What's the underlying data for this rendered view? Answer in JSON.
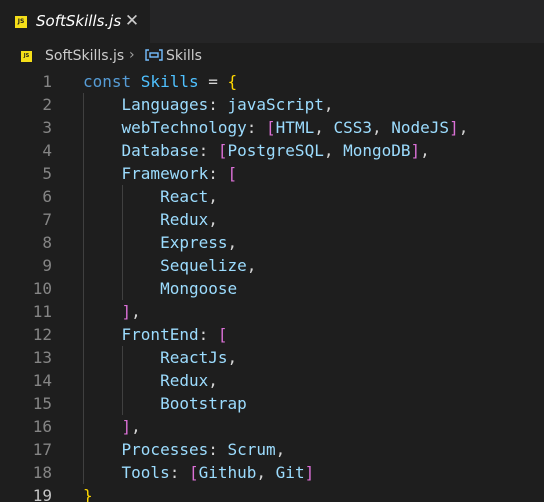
{
  "tab": {
    "badge": "JS",
    "label": "SoftSkills.js",
    "close_glyph": "✕",
    "icon": "javascript-file-icon"
  },
  "breadcrumb": {
    "badge": "JS",
    "file": "SoftSkills.js",
    "separator": "›",
    "symbol_icon": "variable-symbol-icon",
    "symbol": "Skills"
  },
  "editor": {
    "active_line": 19,
    "lines": [
      {
        "n": "1",
        "tokens": [
          [
            "kw",
            "const "
          ],
          [
            "cn",
            "Skills"
          ],
          [
            "op",
            " = "
          ],
          [
            "br1",
            "{"
          ]
        ]
      },
      {
        "n": "2",
        "tokens": [
          [
            "op",
            "    "
          ],
          [
            "pr",
            "Languages"
          ],
          [
            "op",
            ": "
          ],
          [
            "vr",
            "javaScript"
          ],
          [
            "op",
            ","
          ]
        ]
      },
      {
        "n": "3",
        "tokens": [
          [
            "op",
            "    "
          ],
          [
            "pr",
            "webTechnology"
          ],
          [
            "op",
            ": "
          ],
          [
            "br2",
            "["
          ],
          [
            "vr",
            "HTML"
          ],
          [
            "op",
            ", "
          ],
          [
            "vr",
            "CSS3"
          ],
          [
            "op",
            ", "
          ],
          [
            "vr",
            "NodeJS"
          ],
          [
            "br2",
            "]"
          ],
          [
            "op",
            ","
          ]
        ]
      },
      {
        "n": "4",
        "tokens": [
          [
            "op",
            "    "
          ],
          [
            "pr",
            "Database"
          ],
          [
            "op",
            ": "
          ],
          [
            "br2",
            "["
          ],
          [
            "vr",
            "PostgreSQL"
          ],
          [
            "op",
            ", "
          ],
          [
            "vr",
            "MongoDB"
          ],
          [
            "br2",
            "]"
          ],
          [
            "op",
            ","
          ]
        ]
      },
      {
        "n": "5",
        "tokens": [
          [
            "op",
            "    "
          ],
          [
            "pr",
            "Framework"
          ],
          [
            "op",
            ": "
          ],
          [
            "br2",
            "["
          ]
        ]
      },
      {
        "n": "6",
        "tokens": [
          [
            "op",
            "        "
          ],
          [
            "vr",
            "React"
          ],
          [
            "op",
            ","
          ]
        ]
      },
      {
        "n": "7",
        "tokens": [
          [
            "op",
            "        "
          ],
          [
            "vr",
            "Redux"
          ],
          [
            "op",
            ","
          ]
        ]
      },
      {
        "n": "8",
        "tokens": [
          [
            "op",
            "        "
          ],
          [
            "vr",
            "Express"
          ],
          [
            "op",
            ","
          ]
        ]
      },
      {
        "n": "9",
        "tokens": [
          [
            "op",
            "        "
          ],
          [
            "vr",
            "Sequelize"
          ],
          [
            "op",
            ","
          ]
        ]
      },
      {
        "n": "10",
        "tokens": [
          [
            "op",
            "        "
          ],
          [
            "vr",
            "Mongoose"
          ]
        ]
      },
      {
        "n": "11",
        "tokens": [
          [
            "op",
            "    "
          ],
          [
            "br2",
            "]"
          ],
          [
            "op",
            ","
          ]
        ]
      },
      {
        "n": "12",
        "tokens": [
          [
            "op",
            "    "
          ],
          [
            "pr",
            "FrontEnd"
          ],
          [
            "op",
            ": "
          ],
          [
            "br2",
            "["
          ]
        ]
      },
      {
        "n": "13",
        "tokens": [
          [
            "op",
            "        "
          ],
          [
            "vr",
            "ReactJs"
          ],
          [
            "op",
            ","
          ]
        ]
      },
      {
        "n": "14",
        "tokens": [
          [
            "op",
            "        "
          ],
          [
            "vr",
            "Redux"
          ],
          [
            "op",
            ","
          ]
        ]
      },
      {
        "n": "15",
        "tokens": [
          [
            "op",
            "        "
          ],
          [
            "vr",
            "Bootstrap"
          ]
        ]
      },
      {
        "n": "16",
        "tokens": [
          [
            "op",
            "    "
          ],
          [
            "br2",
            "]"
          ],
          [
            "op",
            ","
          ]
        ]
      },
      {
        "n": "17",
        "tokens": [
          [
            "op",
            "    "
          ],
          [
            "pr",
            "Processes"
          ],
          [
            "op",
            ": "
          ],
          [
            "vr",
            "Scrum"
          ],
          [
            "op",
            ","
          ]
        ]
      },
      {
        "n": "18",
        "tokens": [
          [
            "op",
            "    "
          ],
          [
            "pr",
            "Tools"
          ],
          [
            "op",
            ": "
          ],
          [
            "br2",
            "["
          ],
          [
            "vr",
            "Github"
          ],
          [
            "op",
            ", "
          ],
          [
            "vr",
            "Git"
          ],
          [
            "br2",
            "]"
          ]
        ]
      },
      {
        "n": "19",
        "tokens": [
          [
            "br1",
            "}"
          ]
        ]
      }
    ]
  }
}
